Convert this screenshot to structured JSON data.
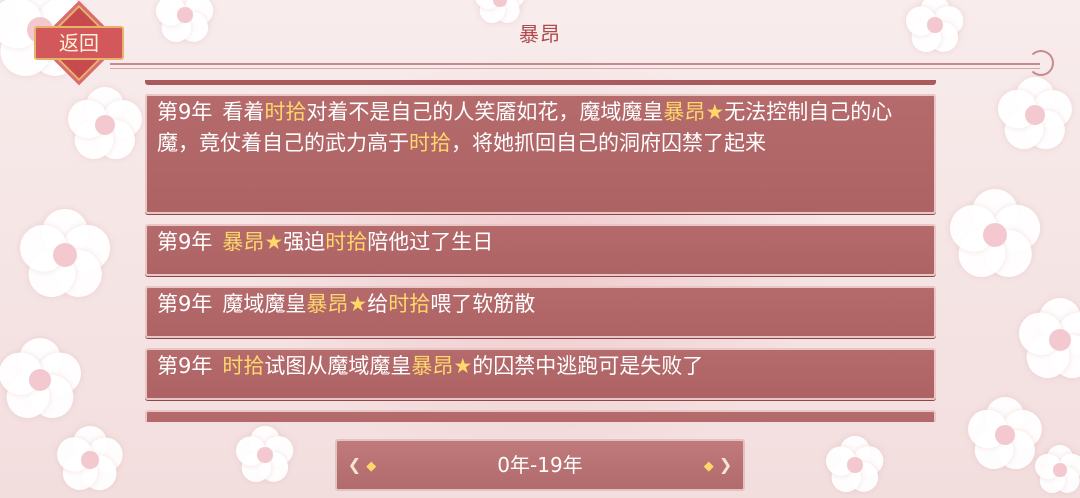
{
  "header": {
    "title": "暴昂",
    "back_label": "返回"
  },
  "events": [
    {
      "year": "第9年",
      "parts": [
        "看着",
        "时拾",
        "对着不是自己的人笑靥如花，魔域魔皇",
        "暴昂",
        "★",
        "无法控制自己的心魔，竟仗着自己的武力高于",
        "时拾",
        "，将她抓回自己的洞府囚禁了起来"
      ]
    },
    {
      "year": "第9年",
      "parts": [
        "",
        "暴昂",
        "★",
        "强迫",
        "时拾",
        "陪他过了生日"
      ]
    },
    {
      "year": "第9年",
      "parts": [
        "魔域魔皇",
        "暴昂",
        "★",
        "给",
        "时拾",
        "喂了软筋散"
      ]
    },
    {
      "year": "第9年",
      "parts": [
        "",
        "时拾",
        "试图从魔域魔皇",
        "暴昂",
        "★",
        "的囚禁中逃跑可是失败了"
      ]
    }
  ],
  "pager": {
    "range_label": "0年-19年"
  },
  "colors": {
    "highlight": "#ffd76a",
    "card": "#b06668",
    "title": "#b04a4c"
  },
  "icons": {
    "prev": "chevron-left-icon",
    "next": "chevron-right-icon",
    "back": "back-icon"
  }
}
